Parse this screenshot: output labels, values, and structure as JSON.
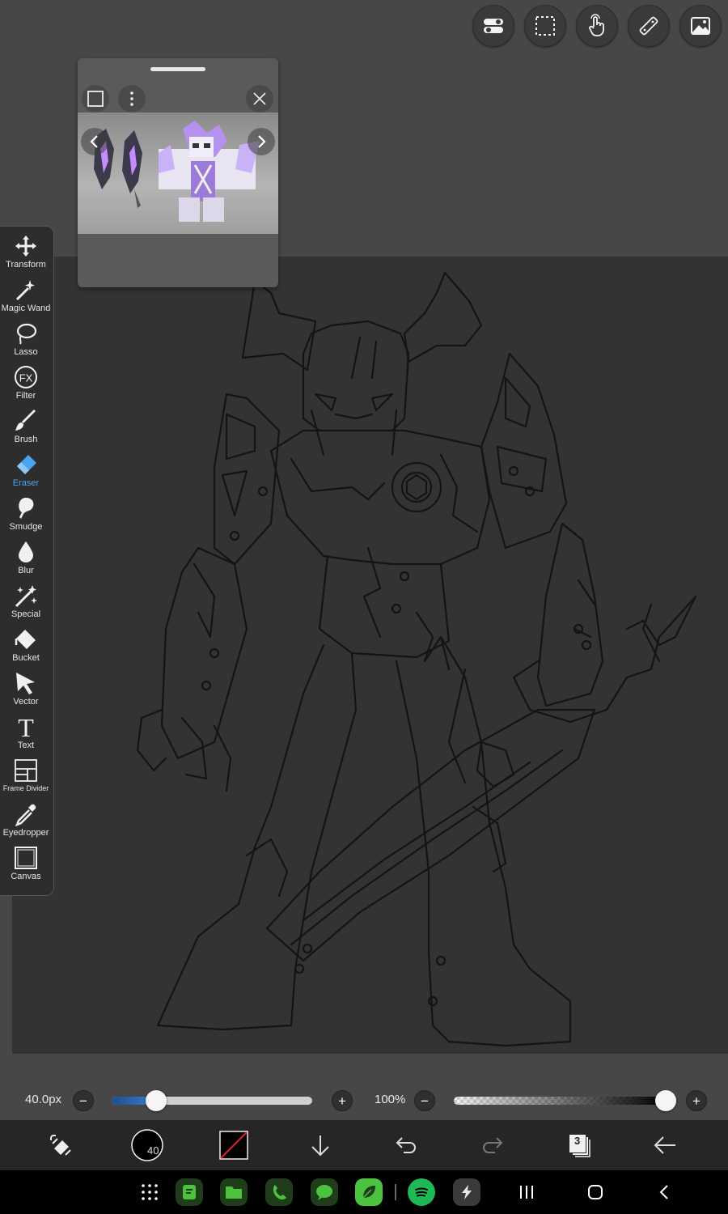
{
  "tools": [
    {
      "label": "Transform",
      "icon": "transform-icon"
    },
    {
      "label": "Magic Wand",
      "icon": "magic-wand-icon"
    },
    {
      "label": "Lasso",
      "icon": "lasso-icon"
    },
    {
      "label": "Filter",
      "icon": "filter-fx-icon",
      "glyph": "FX"
    },
    {
      "label": "Brush",
      "icon": "brush-icon"
    },
    {
      "label": "Eraser",
      "icon": "eraser-icon",
      "active": true
    },
    {
      "label": "Smudge",
      "icon": "smudge-icon"
    },
    {
      "label": "Blur",
      "icon": "blur-drop-icon"
    },
    {
      "label": "Special",
      "icon": "special-icon"
    },
    {
      "label": "Bucket",
      "icon": "bucket-icon"
    },
    {
      "label": "Vector",
      "icon": "vector-arrow-icon"
    },
    {
      "label": "Text",
      "icon": "text-icon",
      "glyph": "T"
    },
    {
      "label": "Frame Divider",
      "icon": "frame-divider-icon"
    },
    {
      "label": "Eyedropper",
      "icon": "eyedropper-icon"
    },
    {
      "label": "Canvas",
      "icon": "canvas-icon"
    }
  ],
  "brush": {
    "size_label": "40.0px",
    "size_fraction": 0.22
  },
  "opacity": {
    "label": "100%",
    "fraction": 1.0
  },
  "bottombar": {
    "brush_size_badge": "40",
    "layer_count": "3"
  },
  "colors": {
    "accent": "#4aa3ef",
    "slider_fill": "#2f5f9e",
    "active_tool": "#4aa3ef"
  }
}
